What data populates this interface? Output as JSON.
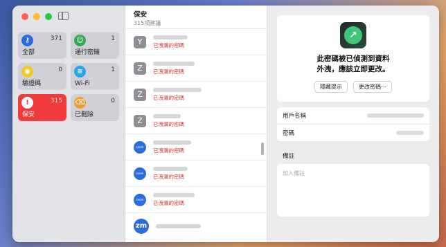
{
  "sidebar": {
    "tiles": [
      {
        "label": "全部",
        "count": "371",
        "icon": "key-icon",
        "color": "#2d6cdf",
        "glyph": "⚷"
      },
      {
        "label": "通行密鑰",
        "count": "1",
        "icon": "passkey-icon",
        "color": "#34a853",
        "glyph": "☺"
      },
      {
        "label": "驗證碼",
        "count": "0",
        "icon": "verification-code-icon",
        "color": "#f2c62f",
        "glyph": "◉"
      },
      {
        "label": "Wi-Fi",
        "count": "1",
        "icon": "wifi-icon",
        "color": "#2aa3e8",
        "glyph": "≋"
      },
      {
        "label": "保安",
        "count": "315",
        "icon": "security-alert-icon",
        "color": "#ef3b3b",
        "glyph": "!"
      },
      {
        "label": "已刪除",
        "count": "0",
        "icon": "trash-icon",
        "color": "#f29a2f",
        "glyph": "⌫"
      }
    ]
  },
  "list": {
    "title": "保安",
    "subtitle": "315項建議",
    "items": [
      {
        "avatar": "Y",
        "warning": "已洩漏的密碼"
      },
      {
        "avatar": "Z",
        "warning": "已洩漏的密碼"
      },
      {
        "avatar": "Z",
        "warning": "已洩漏的密碼"
      },
      {
        "avatar": "Z",
        "warning": "已洩漏的密碼"
      },
      {
        "avatar": "zoom",
        "warning": "已洩漏的密碼"
      },
      {
        "avatar": "zoom",
        "warning": "已洩漏的密碼"
      },
      {
        "avatar": "zoom",
        "warning": "已洩漏的密碼"
      },
      {
        "avatar": "zm",
        "warning": ""
      }
    ]
  },
  "detail": {
    "alert_line1": "此密碼被已偵測到資料",
    "alert_line2": "外洩，應該立即更改。",
    "hide_button": "隱藏提示",
    "change_button": "更改密碼⋯",
    "username_label": "用戶名稱",
    "password_label": "密碼",
    "notes_label": "備註",
    "notes_placeholder": "加入備註"
  }
}
